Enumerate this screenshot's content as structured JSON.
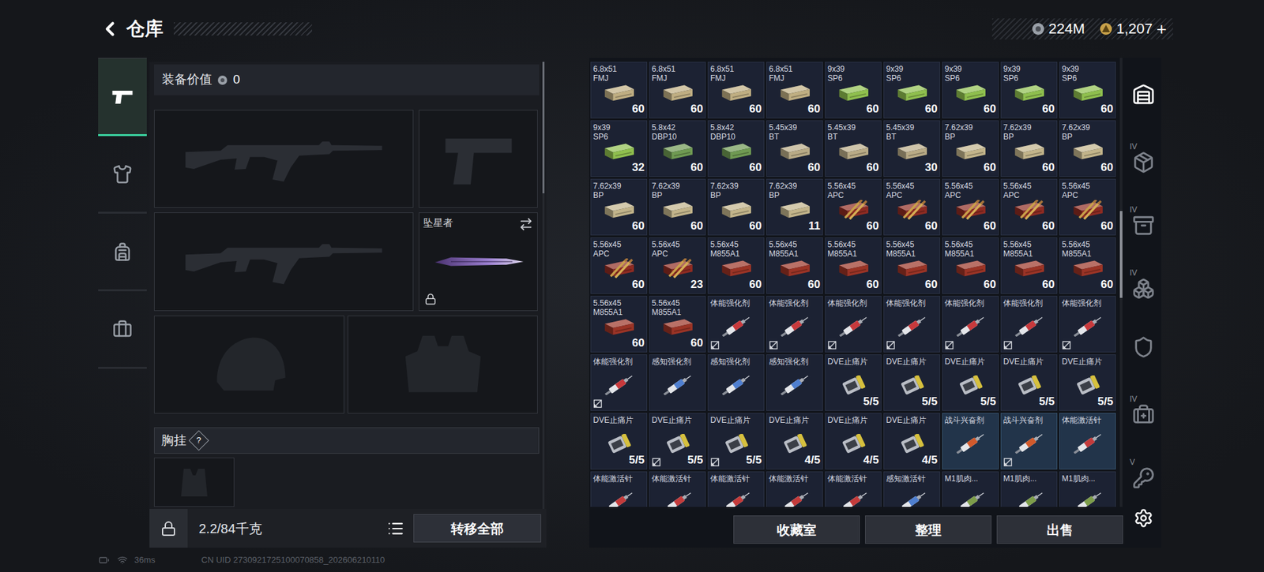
{
  "header": {
    "title": "仓库",
    "currencies": [
      {
        "kind": "silver",
        "value": "224M",
        "action": ""
      },
      {
        "kind": "gold",
        "value": "1,207",
        "action": "+"
      }
    ]
  },
  "rail": [
    {
      "kind": "weapons",
      "selected": true
    },
    {
      "kind": "gear",
      "selected": false
    },
    {
      "kind": "backpack",
      "selected": false
    },
    {
      "kind": "case",
      "selected": false
    }
  ],
  "equipment": {
    "label": "装备价值",
    "value": "0",
    "slots": [
      {
        "kind": "rifle",
        "name": "",
        "locked": false
      },
      {
        "kind": "pistol",
        "name": "",
        "locked": false
      },
      {
        "kind": "rifle",
        "name": "",
        "locked": false
      },
      {
        "kind": "melee",
        "name": "坠星者",
        "locked": true
      },
      {
        "kind": "helmet",
        "name": "",
        "locked": false
      },
      {
        "kind": "armor",
        "name": "",
        "locked": false
      }
    ],
    "chest_rig": {
      "label": "胸挂",
      "help": "?"
    },
    "weight": "2.2/84千克",
    "transfer": "转移全部"
  },
  "stash": {
    "items": [
      {
        "lines": [
          "6.8x51",
          "FMJ"
        ],
        "count": "60",
        "kind": "box",
        "color": "#bfae82",
        "bound": false,
        "new": false
      },
      {
        "lines": [
          "6.8x51",
          "FMJ"
        ],
        "count": "60",
        "kind": "box",
        "color": "#bfae82",
        "bound": false,
        "new": false
      },
      {
        "lines": [
          "6.8x51",
          "FMJ"
        ],
        "count": "60",
        "kind": "box",
        "color": "#bfae82",
        "bound": false,
        "new": false
      },
      {
        "lines": [
          "6.8x51",
          "FMJ"
        ],
        "count": "60",
        "kind": "box",
        "color": "#bfae82",
        "bound": false,
        "new": false
      },
      {
        "lines": [
          "9x39",
          "SP6"
        ],
        "count": "60",
        "kind": "box",
        "color": "#8fbf4e",
        "bound": false,
        "new": false
      },
      {
        "lines": [
          "9x39",
          "SP6"
        ],
        "count": "60",
        "kind": "box",
        "color": "#8fbf4e",
        "bound": false,
        "new": false
      },
      {
        "lines": [
          "9x39",
          "SP6"
        ],
        "count": "60",
        "kind": "box",
        "color": "#8fbf4e",
        "bound": false,
        "new": false
      },
      {
        "lines": [
          "9x39",
          "SP6"
        ],
        "count": "60",
        "kind": "box",
        "color": "#8fbf4e",
        "bound": false,
        "new": false
      },
      {
        "lines": [
          "9x39",
          "SP6"
        ],
        "count": "60",
        "kind": "box",
        "color": "#8fbf4e",
        "bound": false,
        "new": false
      },
      {
        "lines": [
          "9x39",
          "SP6"
        ],
        "count": "32",
        "kind": "box",
        "color": "#8fbf4e",
        "bound": false,
        "new": false
      },
      {
        "lines": [
          "5.8x42",
          "DBP10"
        ],
        "count": "60",
        "kind": "box",
        "color": "#6f9a52",
        "bound": false,
        "new": false
      },
      {
        "lines": [
          "5.8x42",
          "DBP10"
        ],
        "count": "60",
        "kind": "box",
        "color": "#6f9a52",
        "bound": false,
        "new": false
      },
      {
        "lines": [
          "5.45x39",
          "BT"
        ],
        "count": "60",
        "kind": "box",
        "color": "#b9ab86",
        "bound": false,
        "new": false
      },
      {
        "lines": [
          "5.45x39",
          "BT"
        ],
        "count": "60",
        "kind": "box",
        "color": "#b9ab86",
        "bound": false,
        "new": false
      },
      {
        "lines": [
          "5.45x39",
          "BT"
        ],
        "count": "30",
        "kind": "box",
        "color": "#b9ab86",
        "bound": false,
        "new": false
      },
      {
        "lines": [
          "7.62x39",
          "BP"
        ],
        "count": "60",
        "kind": "box",
        "color": "#c2b48a",
        "bound": false,
        "new": false
      },
      {
        "lines": [
          "7.62x39",
          "BP"
        ],
        "count": "60",
        "kind": "box",
        "color": "#c2b48a",
        "bound": false,
        "new": false
      },
      {
        "lines": [
          "7.62x39",
          "BP"
        ],
        "count": "60",
        "kind": "box",
        "color": "#c2b48a",
        "bound": false,
        "new": false
      },
      {
        "lines": [
          "7.62x39",
          "BP"
        ],
        "count": "60",
        "kind": "box",
        "color": "#c2b48a",
        "bound": false,
        "new": false
      },
      {
        "lines": [
          "7.62x39",
          "BP"
        ],
        "count": "60",
        "kind": "box",
        "color": "#c2b48a",
        "bound": false,
        "new": false
      },
      {
        "lines": [
          "7.62x39",
          "BP"
        ],
        "count": "60",
        "kind": "box",
        "color": "#c2b48a",
        "bound": false,
        "new": false
      },
      {
        "lines": [
          "7.62x39",
          "BP"
        ],
        "count": "11",
        "kind": "box",
        "color": "#c2b48a",
        "bound": false,
        "new": false
      },
      {
        "lines": [
          "5.56x45",
          "APC"
        ],
        "count": "60",
        "kind": "cartridge",
        "color": "#8e2b22",
        "bound": false,
        "new": false
      },
      {
        "lines": [
          "5.56x45",
          "APC"
        ],
        "count": "60",
        "kind": "cartridge",
        "color": "#8e2b22",
        "bound": false,
        "new": false
      },
      {
        "lines": [
          "5.56x45",
          "APC"
        ],
        "count": "60",
        "kind": "cartridge",
        "color": "#8e2b22",
        "bound": false,
        "new": false
      },
      {
        "lines": [
          "5.56x45",
          "APC"
        ],
        "count": "60",
        "kind": "cartridge",
        "color": "#8e2b22",
        "bound": false,
        "new": false
      },
      {
        "lines": [
          "5.56x45",
          "APC"
        ],
        "count": "60",
        "kind": "cartridge",
        "color": "#8e2b22",
        "bound": false,
        "new": false
      },
      {
        "lines": [
          "5.56x45",
          "APC"
        ],
        "count": "60",
        "kind": "cartridge",
        "color": "#8e2b22",
        "bound": false,
        "new": false
      },
      {
        "lines": [
          "5.56x45",
          "APC"
        ],
        "count": "23",
        "kind": "cartridge",
        "color": "#8e2b22",
        "bound": false,
        "new": false
      },
      {
        "lines": [
          "5.56x45",
          "M855A1"
        ],
        "count": "60",
        "kind": "box",
        "color": "#9b3426",
        "bound": false,
        "new": false
      },
      {
        "lines": [
          "5.56x45",
          "M855A1"
        ],
        "count": "60",
        "kind": "box",
        "color": "#9b3426",
        "bound": false,
        "new": false
      },
      {
        "lines": [
          "5.56x45",
          "M855A1"
        ],
        "count": "60",
        "kind": "box",
        "color": "#9b3426",
        "bound": false,
        "new": false
      },
      {
        "lines": [
          "5.56x45",
          "M855A1"
        ],
        "count": "60",
        "kind": "box",
        "color": "#9b3426",
        "bound": false,
        "new": false
      },
      {
        "lines": [
          "5.56x45",
          "M855A1"
        ],
        "count": "60",
        "kind": "box",
        "color": "#9b3426",
        "bound": false,
        "new": false
      },
      {
        "lines": [
          "5.56x45",
          "M855A1"
        ],
        "count": "60",
        "kind": "box",
        "color": "#9b3426",
        "bound": false,
        "new": false
      },
      {
        "lines": [
          "5.56x45",
          "M855A1"
        ],
        "count": "60",
        "kind": "box",
        "color": "#9b3426",
        "bound": false,
        "new": false
      },
      {
        "lines": [
          "5.56x45",
          "M855A1"
        ],
        "count": "60",
        "kind": "box",
        "color": "#9b3426",
        "bound": false,
        "new": false
      },
      {
        "lines": [
          "5.56x45",
          "M855A1"
        ],
        "count": "60",
        "kind": "box",
        "color": "#9b3426",
        "bound": false,
        "new": false
      },
      {
        "lines": [
          "体能强化剂"
        ],
        "count": "",
        "kind": "syringe",
        "color": "#c8393c",
        "bound": true,
        "new": false
      },
      {
        "lines": [
          "体能强化剂"
        ],
        "count": "",
        "kind": "syringe",
        "color": "#c8393c",
        "bound": true,
        "new": false
      },
      {
        "lines": [
          "体能强化剂"
        ],
        "count": "",
        "kind": "syringe",
        "color": "#c8393c",
        "bound": true,
        "new": false
      },
      {
        "lines": [
          "体能强化剂"
        ],
        "count": "",
        "kind": "syringe",
        "color": "#c8393c",
        "bound": true,
        "new": false
      },
      {
        "lines": [
          "体能强化剂"
        ],
        "count": "",
        "kind": "syringe",
        "color": "#c8393c",
        "bound": true,
        "new": false
      },
      {
        "lines": [
          "体能强化剂"
        ],
        "count": "",
        "kind": "syringe",
        "color": "#c8393c",
        "bound": true,
        "new": false
      },
      {
        "lines": [
          "体能强化剂"
        ],
        "count": "",
        "kind": "syringe",
        "color": "#c8393c",
        "bound": true,
        "new": false
      },
      {
        "lines": [
          "体能强化剂"
        ],
        "count": "",
        "kind": "syringe",
        "color": "#c8393c",
        "bound": true,
        "new": false
      },
      {
        "lines": [
          "感知强化剂"
        ],
        "count": "",
        "kind": "syringe",
        "color": "#4f7fd0",
        "bound": false,
        "new": false
      },
      {
        "lines": [
          "感知强化剂"
        ],
        "count": "",
        "kind": "syringe",
        "color": "#4f7fd0",
        "bound": false,
        "new": false
      },
      {
        "lines": [
          "感知强化剂"
        ],
        "count": "",
        "kind": "syringe",
        "color": "#4f7fd0",
        "bound": false,
        "new": false
      },
      {
        "lines": [
          "DVE止痛片"
        ],
        "count": "5/5",
        "kind": "pills",
        "color": "#d6c03e",
        "bound": false,
        "new": false
      },
      {
        "lines": [
          "DVE止痛片"
        ],
        "count": "5/5",
        "kind": "pills",
        "color": "#d6c03e",
        "bound": false,
        "new": false
      },
      {
        "lines": [
          "DVE止痛片"
        ],
        "count": "5/5",
        "kind": "pills",
        "color": "#d6c03e",
        "bound": false,
        "new": false
      },
      {
        "lines": [
          "DVE止痛片"
        ],
        "count": "5/5",
        "kind": "pills",
        "color": "#d6c03e",
        "bound": false,
        "new": false
      },
      {
        "lines": [
          "DVE止痛片"
        ],
        "count": "5/5",
        "kind": "pills",
        "color": "#d6c03e",
        "bound": false,
        "new": false
      },
      {
        "lines": [
          "DVE止痛片"
        ],
        "count": "5/5",
        "kind": "pills",
        "color": "#d6c03e",
        "bound": false,
        "new": false
      },
      {
        "lines": [
          "DVE止痛片"
        ],
        "count": "5/5",
        "kind": "pills",
        "color": "#d6c03e",
        "bound": true,
        "new": false
      },
      {
        "lines": [
          "DVE止痛片"
        ],
        "count": "5/5",
        "kind": "pills",
        "color": "#d6c03e",
        "bound": true,
        "new": false
      },
      {
        "lines": [
          "DVE止痛片"
        ],
        "count": "4/5",
        "kind": "pills",
        "color": "#d6c03e",
        "bound": false,
        "new": false
      },
      {
        "lines": [
          "DVE止痛片"
        ],
        "count": "4/5",
        "kind": "pills",
        "color": "#d6c03e",
        "bound": false,
        "new": false
      },
      {
        "lines": [
          "DVE止痛片"
        ],
        "count": "4/5",
        "kind": "pills",
        "color": "#d6c03e",
        "bound": false,
        "new": false
      },
      {
        "lines": [
          "战斗兴奋剂"
        ],
        "count": "",
        "kind": "syringe",
        "color": "#d25a2c",
        "bound": false,
        "new": true
      },
      {
        "lines": [
          "战斗兴奋剂"
        ],
        "count": "",
        "kind": "syringe",
        "color": "#d25a2c",
        "bound": true,
        "new": true
      },
      {
        "lines": [
          "体能激活针"
        ],
        "count": "",
        "kind": "syringe",
        "color": "#c43b3b",
        "bound": false,
        "new": true
      },
      {
        "lines": [
          "体能激活针"
        ],
        "count": "",
        "kind": "syringe",
        "color": "#c43b3b",
        "bound": false,
        "new": false
      },
      {
        "lines": [
          "体能激活针"
        ],
        "count": "",
        "kind": "syringe",
        "color": "#c43b3b",
        "bound": false,
        "new": false
      },
      {
        "lines": [
          "体能激活针"
        ],
        "count": "",
        "kind": "syringe",
        "color": "#c43b3b",
        "bound": false,
        "new": false
      },
      {
        "lines": [
          "体能激活针"
        ],
        "count": "",
        "kind": "syringe",
        "color": "#c43b3b",
        "bound": false,
        "new": false
      },
      {
        "lines": [
          "体能激活针"
        ],
        "count": "",
        "kind": "syringe",
        "color": "#c43b3b",
        "bound": false,
        "new": false
      },
      {
        "lines": [
          "感知激活针"
        ],
        "count": "",
        "kind": "syringe",
        "color": "#4f7fd0",
        "bound": false,
        "new": false
      },
      {
        "lines": [
          "M1肌肉..."
        ],
        "count": "",
        "kind": "syringe",
        "color": "#7d9d4a",
        "bound": false,
        "new": false
      },
      {
        "lines": [
          "M1肌肉..."
        ],
        "count": "",
        "kind": "syringe",
        "color": "#7d9d4a",
        "bound": false,
        "new": false
      },
      {
        "lines": [
          "M1肌肉..."
        ],
        "count": "",
        "kind": "syringe",
        "color": "#7d9d4a",
        "bound": false,
        "new": false
      }
    ]
  },
  "buttons": [
    "收藏室",
    "整理",
    "出售"
  ],
  "side_tabs": [
    {
      "kind": "home",
      "tier": "",
      "selected": true
    },
    {
      "kind": "rifle",
      "tier": "IV",
      "selected": false
    },
    {
      "kind": "weapon",
      "tier": "IV",
      "selected": false
    },
    {
      "kind": "case",
      "tier": "IV",
      "selected": false
    },
    {
      "kind": "gear",
      "tier": "",
      "selected": false
    },
    {
      "kind": "medical",
      "tier": "IV",
      "selected": false
    },
    {
      "kind": "key",
      "tier": "V",
      "selected": false
    }
  ],
  "status": {
    "ping": "36ms",
    "uid": "CN UID 2730921725100070858_202606210110"
  }
}
